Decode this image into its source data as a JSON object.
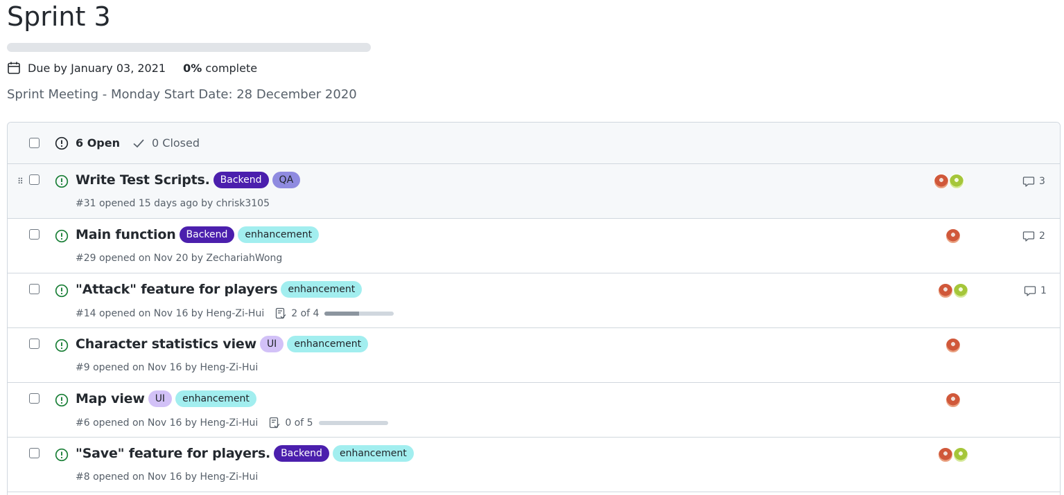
{
  "milestone": {
    "title": "Sprint 3",
    "progress_percent": 0,
    "due": "Due by January 03, 2021",
    "complete_value": "0%",
    "complete_suffix": " complete",
    "description": "Sprint Meeting - Monday Start Date: 28 December 2020"
  },
  "header": {
    "open_label": "6 Open",
    "closed_label": "0 Closed"
  },
  "issues": [
    {
      "title": "Write Test Scripts.",
      "labels": [
        "Backend",
        "QA"
      ],
      "meta": "#31 opened 15 days ago by chrisk3105",
      "comments": "3",
      "avatars": [
        "red",
        "green"
      ]
    },
    {
      "title": "Main function",
      "labels": [
        "Backend",
        "enhancement"
      ],
      "meta": "#29 opened on Nov 20 by ZechariahWong",
      "comments": "2",
      "avatars": [
        "red"
      ]
    },
    {
      "title": "\"Attack\" feature for players",
      "labels": [
        "enhancement"
      ],
      "meta": "#14 opened on Nov 16 by Heng-Zi-Hui",
      "tasks": "2 of 4",
      "tasks_progress": 0.5,
      "comments": "1",
      "avatars": [
        "red",
        "green"
      ]
    },
    {
      "title": "Character statistics view",
      "labels": [
        "UI",
        "enhancement"
      ],
      "meta": "#9 opened on Nov 16 by Heng-Zi-Hui",
      "avatars": [
        "red"
      ]
    },
    {
      "title": "Map view",
      "labels": [
        "UI",
        "enhancement"
      ],
      "meta": "#6 opened on Nov 16 by Heng-Zi-Hui",
      "tasks": "0 of 5",
      "tasks_progress": 0,
      "avatars": [
        "red"
      ]
    },
    {
      "title": "\"Save\" feature for players.",
      "labels": [
        "Backend",
        "enhancement"
      ],
      "meta": "#8 opened on Nov 16 by Heng-Zi-Hui",
      "avatars": [
        "red",
        "green"
      ]
    }
  ],
  "colors": {
    "open_icon": "#1a7f37",
    "backend": "#4b1fad",
    "qa": "#8f8be0",
    "enhancement": "#a2eeef",
    "ui": "#d2c1f7"
  }
}
